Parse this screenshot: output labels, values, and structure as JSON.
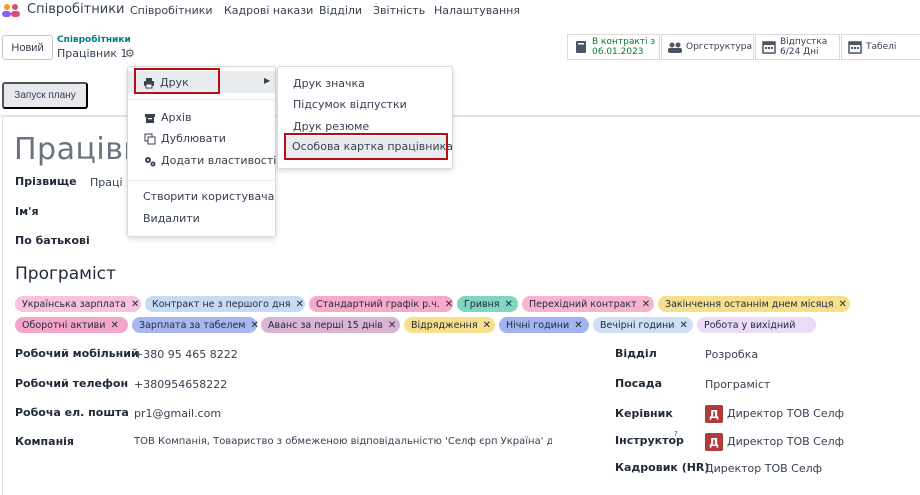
{
  "app": {
    "name": "Співробітники"
  },
  "nav": [
    "Співробітники",
    "Кадрові накази",
    "Відділи",
    "Звітність",
    "Налаштування"
  ],
  "control": {
    "new_label": "Новий",
    "breadcrumb_parent": "Співробітники",
    "breadcrumb_current": "Працівник 1",
    "plan_label": "Запуск плану"
  },
  "smart_buttons": [
    {
      "line1": "В контракті з",
      "line2": "06.01.2023",
      "icon": "book-icon"
    },
    {
      "line1": "Оргструктура",
      "line2": "",
      "icon": "users-icon"
    },
    {
      "line1": "Відпустка",
      "line2": "6/24 Дні",
      "icon": "calendar-icon"
    },
    {
      "line1": "Табелі",
      "line2": "",
      "icon": "calendar-icon"
    }
  ],
  "employee": {
    "name_partial": "Працівни",
    "surname_label": "Прізвище",
    "surname_value": "Праці",
    "first_name_label": "Ім'я",
    "patronymic_label": "По батькові",
    "job_title": "Програміст"
  },
  "tags": [
    {
      "label": "Українська зарплата",
      "color": "#f8c3dc"
    },
    {
      "label": "Контракт не з першого дня",
      "color": "#c6dcf5"
    },
    {
      "label": "Стандартний графік р.ч.",
      "color": "#f6a9c9"
    },
    {
      "label": "Гривня",
      "color": "#7fd6c1"
    },
    {
      "label": "Перехідний контракт",
      "color": "#f8b4cf"
    },
    {
      "label": "Закінчення останнім днем місяця",
      "color": "#f7e08c"
    },
    {
      "label": "Оборотні активи",
      "color": "#f4a6c8"
    },
    {
      "label": "Зарплата за табелем",
      "color": "#a9b6f0"
    },
    {
      "label": "Аванс за перші 15 днів",
      "color": "#d9b4d3"
    },
    {
      "label": "Відрядження",
      "color": "#f7df8e"
    },
    {
      "label": "Нічні години",
      "color": "#a3b3ef"
    },
    {
      "label": "Вечірні години",
      "color": "#cfe0f5"
    },
    {
      "label": "Робота у вихідний",
      "color": "#eadcf7"
    }
  ],
  "fields_left": [
    {
      "label": "Робочий мобільний",
      "value": "+380 95 465 8222"
    },
    {
      "label": "Робочий телефон",
      "value": "+380954658222"
    },
    {
      "label": "Робоча ел. пошта",
      "value": "pr1@gmail.com"
    },
    {
      "label": "Компанія",
      "value": "ТОВ Компанія, Товариство з обмеженою відповідальністю 'Селф єрп Україна' для"
    }
  ],
  "fields_right": [
    {
      "label": "Відділ",
      "value": "Розробка"
    },
    {
      "label": "Посада",
      "value": "Програміст"
    },
    {
      "label": "Керівник",
      "value": "Директор ТОВ Селф",
      "avatar": "Д"
    },
    {
      "label": "Інструктор",
      "value": "Директор ТОВ Селф",
      "avatar": "Д",
      "help": "?"
    },
    {
      "label": "Кадровик (HR)",
      "value": "Директор ТОВ Селф"
    }
  ],
  "menu_main": {
    "print": "Друк",
    "archive": "Архів",
    "duplicate": "Дублювати",
    "add_properties": "Додати властивості",
    "create_user": "Створити користувача",
    "delete": "Видалити"
  },
  "menu_print": [
    "Друк значка",
    "Підсумок відпустки",
    "Друк резюме",
    "Особова картка працівника"
  ]
}
